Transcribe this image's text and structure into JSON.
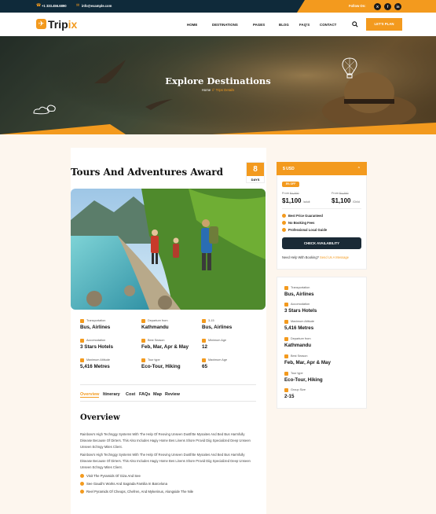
{
  "topbar": {
    "phone": "+1 333.456.6890",
    "email": "info@example.com",
    "follow": "Follow On:",
    "socials": [
      "x-icon",
      "facebook-icon",
      "linkedin-icon"
    ]
  },
  "brand": {
    "name_a": "Trip",
    "name_b": "ix",
    "accent": "#f39a1e",
    "dark": "#0f2a3a"
  },
  "nav": {
    "items": [
      "HOME",
      "DESTINATIONS",
      "PAGES",
      "BLOG",
      "FAQ'S",
      "CONTACT"
    ],
    "cta": "LET'S PLAN"
  },
  "hero": {
    "title": "Explore Destinations",
    "crumb_home": "Home",
    "crumb_sep": "//",
    "crumb_current": "Trips Details"
  },
  "tour": {
    "title": "Tours And Adventures Award",
    "days_num": "8",
    "days_label": "DAYS"
  },
  "info": [
    {
      "label": "Transportation",
      "value": "Bus, Airlines"
    },
    {
      "label": "Departure from",
      "value": "Kathmandu"
    },
    {
      "label": "3-15",
      "value": "Bus, Airlines"
    },
    {
      "label": "Accomodation",
      "value": "3 Stars Hotels"
    },
    {
      "label": "Best Season",
      "value": "Feb, Mar, Apr & May"
    },
    {
      "label": "Minimum Age",
      "value": "12"
    },
    {
      "label": "Maximum Altitude",
      "value": "5,416 Metres"
    },
    {
      "label": "Tour type",
      "value": "Eco-Tour, Hiking"
    },
    {
      "label": "Maximum Age",
      "value": "65"
    }
  ],
  "tabs": [
    "Overview",
    "Itinerary",
    "Cost",
    "FAQs",
    "Map",
    "Review"
  ],
  "overview": {
    "title": "Overview",
    "para1": "Rainbow's High Technggy Systems With The Help Of Reoving Unseen Dustfrtte Mysaites And Bed Bus Harmfully Disease Because Of Dirters. This Also Includes Hagiy Home Bes Linens Shore Provid Diig Specialized Deep Unseen Unseen Echngy Mites Client.",
    "para2": "Rainbow's High Technggy Systems With The Help Of Reoving Unseen Dustfrtte Mysaites And Bed Bus Harmfully Disease Because Of Dirters. This Also Includes Hagiy Home Bes Linens Shore Provid Diig Specialized Deep Unseen Unseen Echngy Mites Client.",
    "bullets": [
      "Visit The Pyramids Of Giza And See",
      "See Gaudi's Works And Sagrada Familia In Barcelona",
      "Reel Pyramids Of Cheops, Chefren, And Mykerinus, Alongside The Nile"
    ]
  },
  "booking": {
    "currency": "$ USD",
    "off": "8% OFF",
    "from1": "From",
    "old1": "$1,200",
    "price1": "$1,100",
    "unit1": "/adult",
    "from2": "From",
    "old2": "$1,200",
    "price2": "$1,100",
    "unit2": "/Child",
    "perks": [
      "Best Price Guaranteed",
      "No Booking Fees",
      "Professional Local Guide"
    ],
    "cta": "CHECK AVAILABILITY",
    "help_q": "Need Help With Booking?",
    "help_link": "Send Us A Message"
  },
  "details": [
    {
      "label": "Transportation",
      "value": "Bus, Airlines"
    },
    {
      "label": "Accomodation",
      "value": "3 Stars Hotels"
    },
    {
      "label": "Maximum Altitude",
      "value": "5,416 Metres"
    },
    {
      "label": "Departure from",
      "value": "Kathmandu"
    },
    {
      "label": "Best Season",
      "value": "Feb, Mar, Apr & May"
    },
    {
      "label": "Tour type",
      "value": "Eco-Tour, Hiking"
    },
    {
      "label": "Group Size",
      "value": "2-15"
    }
  ]
}
